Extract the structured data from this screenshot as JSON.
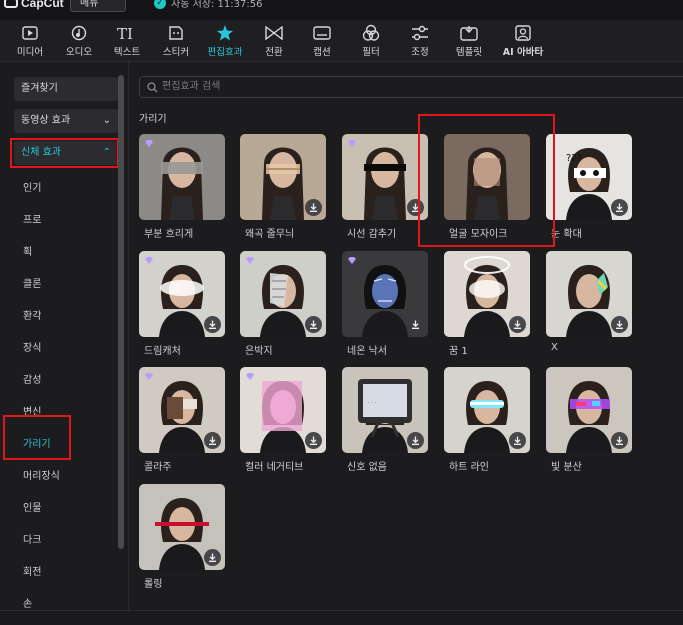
{
  "app": {
    "logo_text": "CapCut",
    "menu_label": "메뉴",
    "save_status": "자동 저장: 11:37:56"
  },
  "toolbar": [
    {
      "label": "미디어",
      "icon": "media-icon"
    },
    {
      "label": "오디오",
      "icon": "audio-icon"
    },
    {
      "label": "텍스트",
      "icon": "text-icon"
    },
    {
      "label": "스티커",
      "icon": "sticker-icon"
    },
    {
      "label": "편집효과",
      "icon": "effects-icon",
      "active": true
    },
    {
      "label": "전환",
      "icon": "transition-icon"
    },
    {
      "label": "캡션",
      "icon": "captions-icon"
    },
    {
      "label": "필터",
      "icon": "filter-icon"
    },
    {
      "label": "조정",
      "icon": "adjust-icon"
    },
    {
      "label": "템플릿",
      "icon": "template-icon"
    },
    {
      "label": "AI 아바타",
      "icon": "ai-avatar-icon"
    }
  ],
  "sidebar": {
    "favorites": "즐겨찾기",
    "video_effects": "동영상 효과",
    "body_effects": "신체 효과",
    "items": [
      "인기",
      "프로",
      "획",
      "클론",
      "환각",
      "장식",
      "감성",
      "변신",
      "가리기",
      "머리장식",
      "인물",
      "다크",
      "회전",
      "손"
    ],
    "active_item": "가리기"
  },
  "search": {
    "placeholder": "편집효과 검색"
  },
  "section_title": "가리기",
  "effects": [
    {
      "label": "부분 흐리게",
      "premium": true,
      "downloaded": false
    },
    {
      "label": "왜곡 줄무늬",
      "premium": false,
      "downloaded": true
    },
    {
      "label": "시선 감추기",
      "premium": true,
      "downloaded": true
    },
    {
      "label": "얼굴 모자이크",
      "premium": false,
      "downloaded": false
    },
    {
      "label": "눈 확대",
      "premium": false,
      "downloaded": true
    },
    {
      "label": "드림캐처",
      "premium": true,
      "downloaded": true
    },
    {
      "label": "은박지",
      "premium": true,
      "downloaded": true
    },
    {
      "label": "네온 낙서",
      "premium": true,
      "downloaded": true
    },
    {
      "label": "꿈 1",
      "premium": false,
      "downloaded": true
    },
    {
      "label": "X",
      "premium": false,
      "downloaded": true
    },
    {
      "label": "콜라주",
      "premium": true,
      "downloaded": true
    },
    {
      "label": "컬러 네거티브",
      "premium": true,
      "downloaded": true
    },
    {
      "label": "신호 없음",
      "premium": false,
      "downloaded": true
    },
    {
      "label": "하트 라인",
      "premium": false,
      "downloaded": true
    },
    {
      "label": "빛 분산",
      "premium": false,
      "downloaded": true
    },
    {
      "label": "롤링",
      "premium": false,
      "downloaded": true
    }
  ],
  "colors": {
    "accent": "#27c6d8",
    "highlight_box": "#e0161b",
    "background": "#1c1c1f"
  }
}
